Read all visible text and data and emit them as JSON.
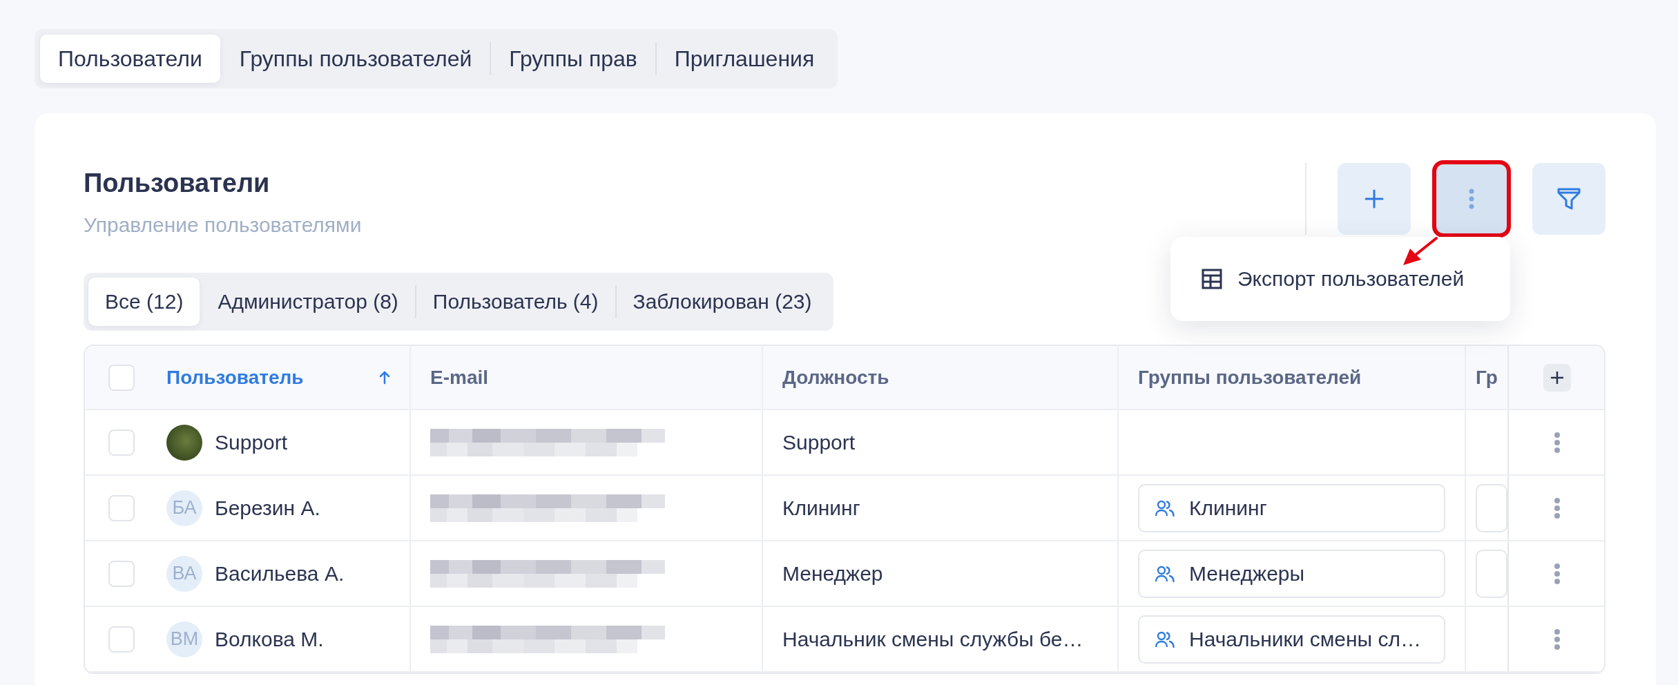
{
  "top_tabs": [
    {
      "label": "Пользователи",
      "selected": true
    },
    {
      "label": "Группы пользователей",
      "selected": false
    },
    {
      "label": "Группы прав",
      "selected": false
    },
    {
      "label": "Приглашения",
      "selected": false
    }
  ],
  "section": {
    "title": "Пользователи",
    "subtitle": "Управление пользователями"
  },
  "toolbar": [
    {
      "kind": "add",
      "highlighted": false
    },
    {
      "kind": "more",
      "highlighted": true
    },
    {
      "kind": "filter",
      "highlighted": false
    }
  ],
  "menu": {
    "items": [
      {
        "label": "Экспорт пользователей"
      }
    ]
  },
  "filter_tabs": [
    {
      "label": "Все (12)",
      "selected": true
    },
    {
      "label": "Администратор (8)",
      "selected": false
    },
    {
      "label": "Пользователь (4)",
      "selected": false
    },
    {
      "label": "Заблокирован (23)",
      "selected": false
    }
  ],
  "table": {
    "select_all_checked": false,
    "columns": [
      {
        "label": "Пользователь",
        "sorted": true
      },
      {
        "label": "E-mail",
        "sorted": false
      },
      {
        "label": "Должность",
        "sorted": false
      },
      {
        "label": "Группы пользователей",
        "sorted": false
      },
      {
        "label": "Гр",
        "sorted": false
      }
    ],
    "rows": [
      {
        "checked": false,
        "avatar": {
          "kind": "photo"
        },
        "name": "Support",
        "email": {
          "kind": "redacted"
        },
        "position": "Support",
        "column_5_chip": false
      },
      {
        "checked": false,
        "avatar": {
          "kind": "initials",
          "text": "БА"
        },
        "name": "Березин А.",
        "email": {
          "kind": "redacted"
        },
        "position": "Клининг",
        "group": "Клининг",
        "column_5_chip": true
      },
      {
        "checked": false,
        "avatar": {
          "kind": "initials",
          "text": "ВА"
        },
        "name": "Васильева А.",
        "email": {
          "kind": "redacted"
        },
        "position": "Менеджер",
        "group": "Менеджеры",
        "column_5_chip": true
      },
      {
        "checked": false,
        "avatar": {
          "kind": "initials",
          "text": "ВМ"
        },
        "name": "Волкова М.",
        "email": {
          "kind": "redacted"
        },
        "position": "Начальник смены службы бе…",
        "group": "Начальники смены сл…",
        "column_5_chip": false
      }
    ]
  }
}
